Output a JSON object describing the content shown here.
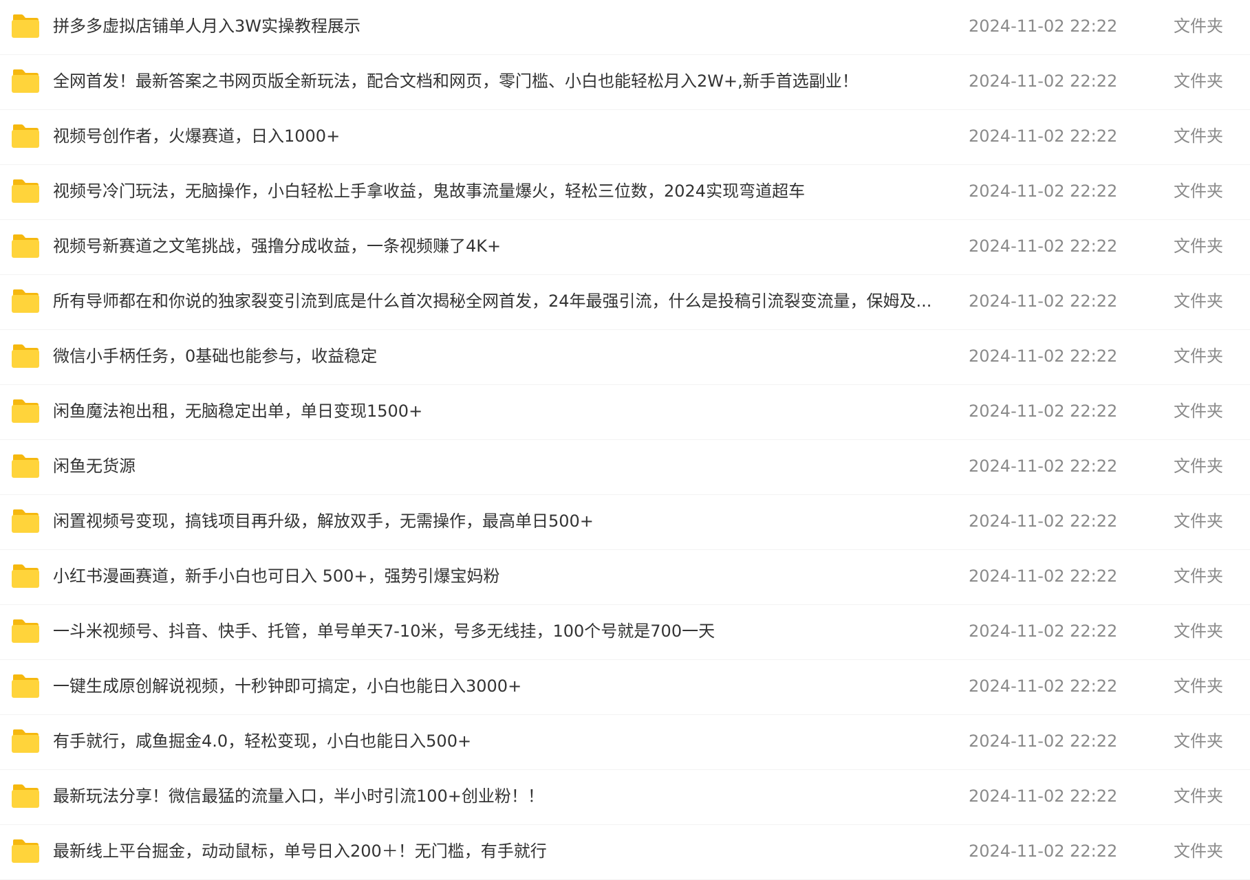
{
  "colors": {
    "folder_body": "#FFD43B",
    "folder_tab": "#F5B80F",
    "name_text": "#333333",
    "meta_text": "#8A8A8A"
  },
  "files": [
    {
      "icon": "folder-icon",
      "name": "拼多多虚拟店铺单人月入3W实操教程展示",
      "date": "2024-11-02 22:22",
      "type": "文件夹"
    },
    {
      "icon": "folder-icon",
      "name": "全网首发！最新答案之书网页版全新玩法，配合文档和网页，零门槛、小白也能轻松月入2W+,新手首选副业！",
      "date": "2024-11-02 22:22",
      "type": "文件夹"
    },
    {
      "icon": "folder-icon",
      "name": "视频号创作者，火爆赛道，日入1000+",
      "date": "2024-11-02 22:22",
      "type": "文件夹"
    },
    {
      "icon": "folder-icon",
      "name": "视频号冷门玩法，无脑操作，小白轻松上手拿收益，鬼故事流量爆火，轻松三位数，2024实现弯道超车",
      "date": "2024-11-02 22:22",
      "type": "文件夹"
    },
    {
      "icon": "folder-icon",
      "name": "视频号新赛道之文笔挑战，强撸分成收益，一条视频赚了4K+",
      "date": "2024-11-02 22:22",
      "type": "文件夹"
    },
    {
      "icon": "folder-icon",
      "name": "所有导师都在和你说的独家裂变引流到底是什么首次揭秘全网首发，24年最强引流，什么是投稿引流裂变流量，保姆及...",
      "date": "2024-11-02 22:22",
      "type": "文件夹"
    },
    {
      "icon": "folder-icon",
      "name": "微信小手柄任务，0基础也能参与，收益稳定",
      "date": "2024-11-02 22:22",
      "type": "文件夹"
    },
    {
      "icon": "folder-icon",
      "name": "闲鱼魔法袍出租，无脑稳定出单，单日变现1500+",
      "date": "2024-11-02 22:22",
      "type": "文件夹"
    },
    {
      "icon": "folder-icon",
      "name": "闲鱼无货源",
      "date": "2024-11-02 22:22",
      "type": "文件夹"
    },
    {
      "icon": "folder-icon",
      "name": "闲置视频号变现，搞钱项目再升级，解放双手，无需操作，最高单日500+",
      "date": "2024-11-02 22:22",
      "type": "文件夹"
    },
    {
      "icon": "folder-icon",
      "name": "小红书漫画赛道，新手小白也可日入 500+，强势引爆宝妈粉",
      "date": "2024-11-02 22:22",
      "type": "文件夹"
    },
    {
      "icon": "folder-icon",
      "name": "一斗米视频号、抖音、快手、托管，单号单天7-10米，号多无线挂，100个号就是700一天",
      "date": "2024-11-02 22:22",
      "type": "文件夹"
    },
    {
      "icon": "folder-icon",
      "name": "一键生成原创解说视频，十秒钟即可搞定，小白也能日入3000+",
      "date": "2024-11-02 22:22",
      "type": "文件夹"
    },
    {
      "icon": "folder-icon",
      "name": "有手就行，咸鱼掘金4.0，轻松变现，小白也能日入500+",
      "date": "2024-11-02 22:22",
      "type": "文件夹"
    },
    {
      "icon": "folder-icon",
      "name": "最新玩法分享！微信最猛的流量入口，半小时引流100+创业粉！！",
      "date": "2024-11-02 22:22",
      "type": "文件夹"
    },
    {
      "icon": "folder-icon",
      "name": "最新线上平台掘金，动动鼠标，单号日入200＋！无门槛，有手就行",
      "date": "2024-11-02 22:22",
      "type": "文件夹"
    }
  ]
}
